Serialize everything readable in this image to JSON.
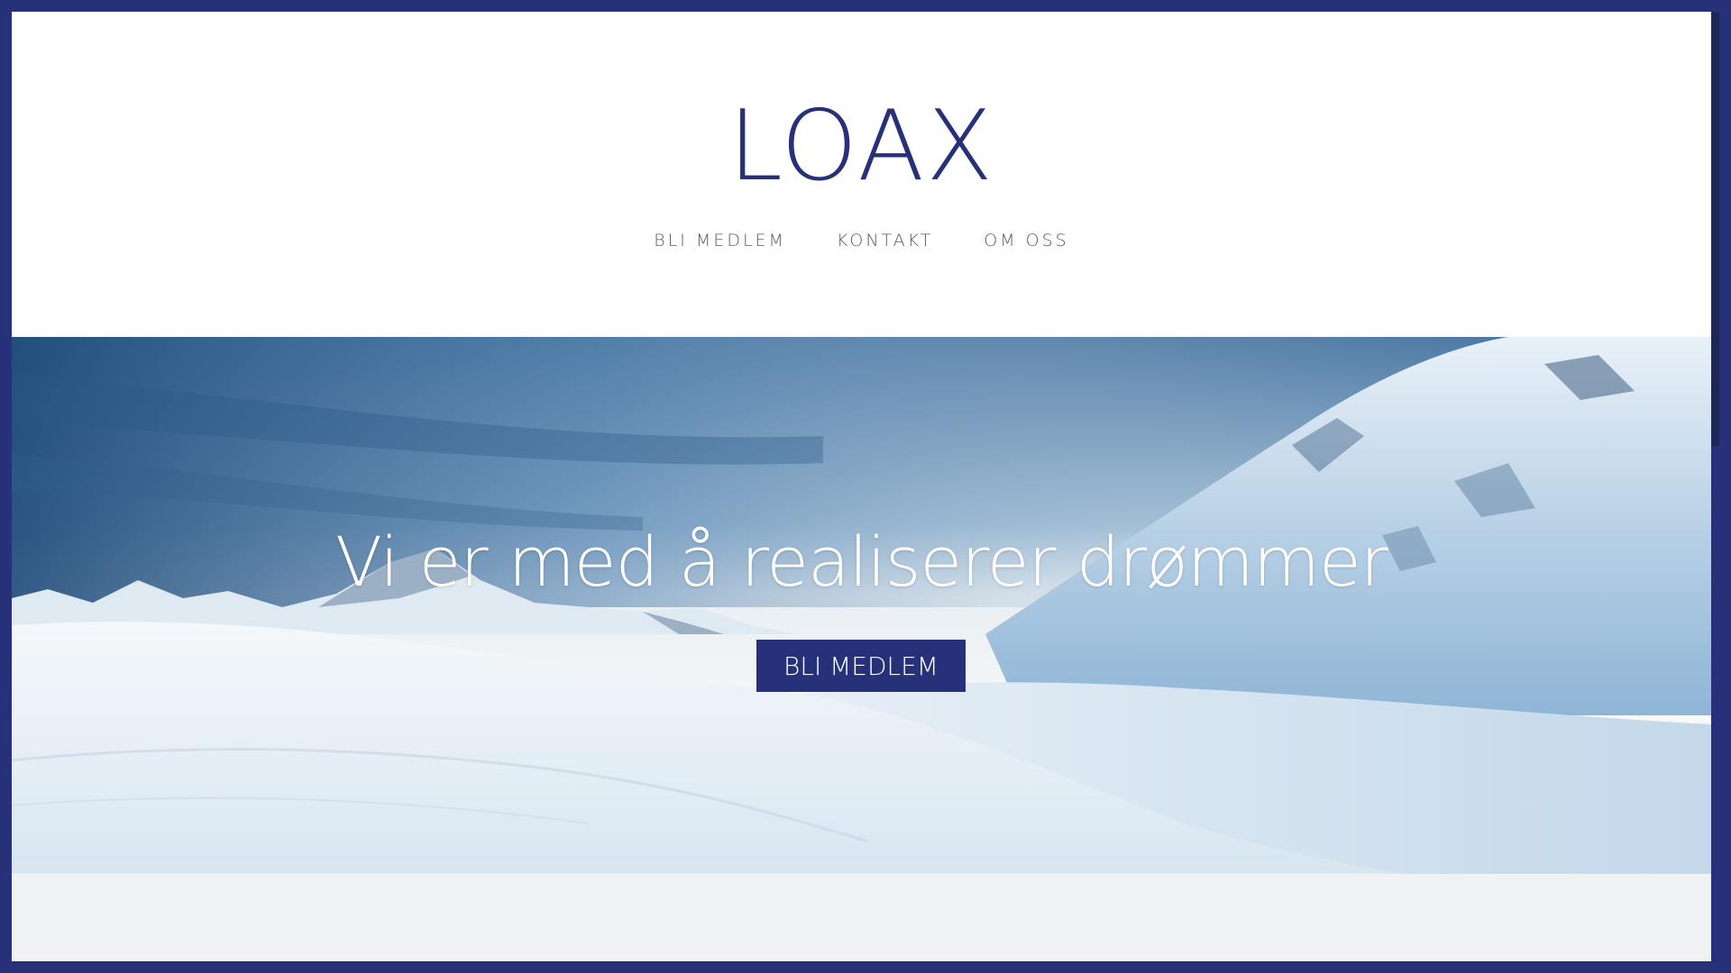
{
  "header": {
    "logo": "LOAX",
    "nav": [
      {
        "label": "BLI MEDLEM"
      },
      {
        "label": "KONTAKT"
      },
      {
        "label": "OM OSS"
      }
    ]
  },
  "hero": {
    "title": "Vi er med å realiserer drømmer",
    "cta_label": "BLI MEDLEM"
  },
  "colors": {
    "brand": "#27317a",
    "frame_background": "#f0f2f3",
    "header_background": "#ffffff",
    "nav_text": "#555b66"
  }
}
